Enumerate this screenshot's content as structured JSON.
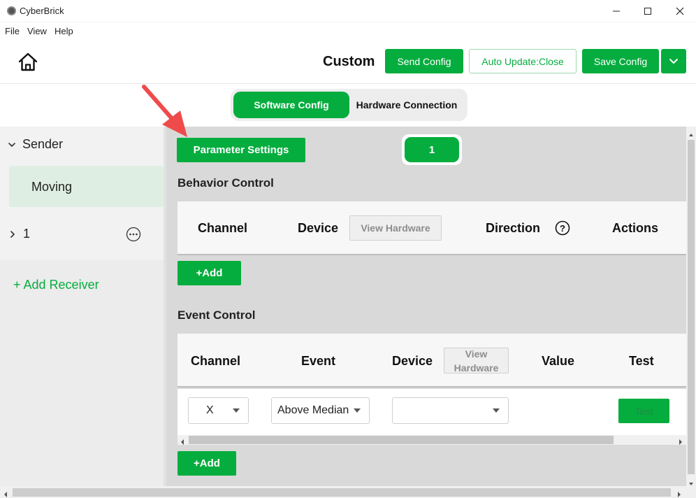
{
  "window": {
    "title": "CyberBrick"
  },
  "menu": [
    "File",
    "View",
    "Help"
  ],
  "header": {
    "title": "Custom",
    "send_config": "Send Config",
    "auto_update": "Auto Update:Close",
    "save_config": "Save Config"
  },
  "tabs": [
    {
      "label": "Software Config",
      "active": true
    },
    {
      "label": "Hardware Connection",
      "active": false
    }
  ],
  "sidebar": {
    "sender_label": "Sender",
    "moving_label": "Moving",
    "receiver_label": "1",
    "add_receiver": "+ Add Receiver"
  },
  "main": {
    "param_settings": "Parameter Settings",
    "channel_badge": "1",
    "behavior": {
      "title": "Behavior Control",
      "headers": {
        "channel": "Channel",
        "device": "Device",
        "direction": "Direction",
        "actions": "Actions"
      },
      "view_hardware": "View Hardware",
      "add": "+Add"
    },
    "event": {
      "title": "Event Control",
      "headers": {
        "channel": "Channel",
        "event": "Event",
        "device": "Device",
        "value": "Value",
        "test": "Test"
      },
      "view_hardware": "View Hardware",
      "row": {
        "channel": "X",
        "event": "Above Median",
        "device": "",
        "test": "Test"
      },
      "add": "+Add"
    }
  },
  "colors": {
    "accent": "#05ad3e",
    "selected_item_bg": "#dfeee2",
    "annotation_arrow": "#ef4b4b"
  }
}
